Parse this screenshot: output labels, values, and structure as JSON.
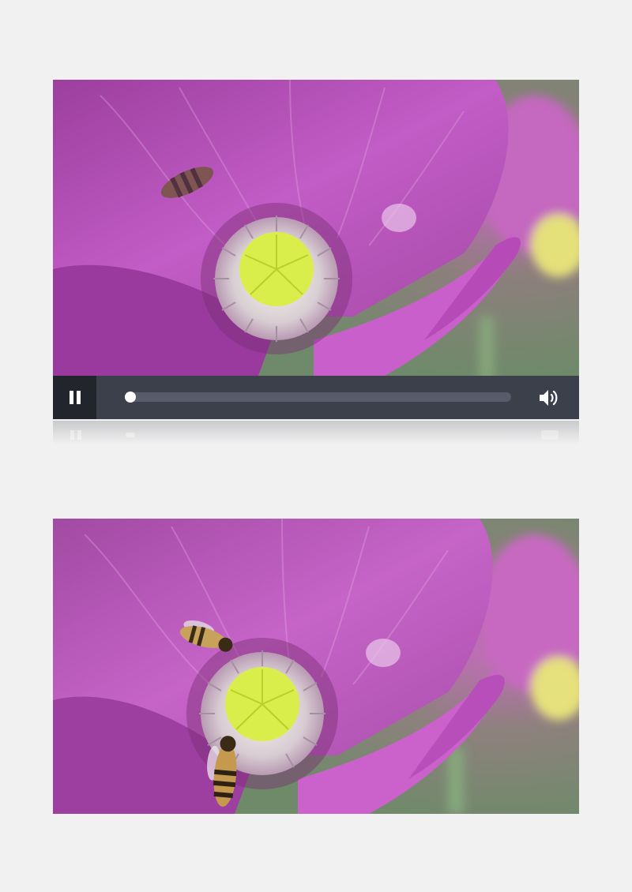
{
  "player": {
    "state": "paused",
    "progress": 0.0,
    "controls": {
      "play_pause_icon": "pause-icon",
      "volume_icon": "volume-icon"
    }
  },
  "frames": [
    {
      "subject": "poppy-flower",
      "bees": 1
    },
    {
      "subject": "poppy-flower",
      "bees": 2
    }
  ],
  "colors": {
    "page_background": "#f1f1f1",
    "control_bar": "#3c404b",
    "play_button": "#22252b",
    "track": "#575c6a",
    "petal": "#b04fb3",
    "stigma": "#d9ee4a"
  }
}
